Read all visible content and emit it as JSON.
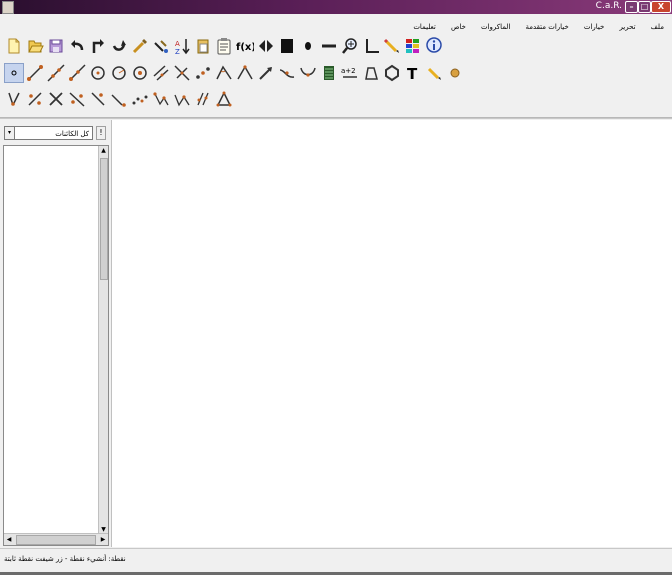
{
  "window": {
    "title": "C.a.R."
  },
  "menu": {
    "items": [
      "ملف",
      "تحرير",
      "خيارات",
      "خيارات متقدمة",
      "الماكروات",
      "خاص",
      "تعليمات"
    ]
  },
  "toolbar": {
    "row1": [
      "new-file-icon",
      "open-file-icon",
      "save-file-icon",
      "undo-icon",
      "redo-reset-icon",
      "back-icon",
      "delete-icon",
      "edit-icon",
      "sort-icon",
      "clipboard-icon",
      "clipboard-text-icon",
      "function-icon",
      "mirror-icon",
      "black-square-icon",
      "dot-icon",
      "line-thickness-icon",
      "zoom-icon",
      "axes-icon",
      "pencil-icon",
      "color-grid-icon",
      "info-icon"
    ],
    "row1_function_label": "f(x)",
    "row2": [
      "point-icon",
      "segment-icon",
      "line-icon",
      "ray-icon",
      "circle-icon",
      "circle-radius-icon",
      "compass-circle-icon",
      "parallel-icon",
      "perpendicular-icon",
      "midpoint-icon",
      "angle-icon",
      "fixed-angle-icon",
      "vector-icon",
      "arc-icon",
      "conic-icon",
      "function-graph-icon",
      "expression-icon",
      "polygon-icon",
      "regular-polygon-icon",
      "text-icon",
      "pencil-tool-icon",
      "color-ball-icon"
    ],
    "row2_expression_label": "a+2",
    "row2_text_label": "T",
    "row3": [
      "intersection-icon",
      "bisector-icon",
      "cross-icon",
      "tangent-icon",
      "reflect-icon",
      "rotate-icon",
      "chain-icon",
      "triangle-chain-icon",
      "broken-line-icon",
      "multiple-points-icon",
      "triangle-icon"
    ]
  },
  "sidepanel": {
    "combo_value": "كل الكائنات",
    "combo_arrow": "▾",
    "exclaim": "!",
    "scroll_up": "▲",
    "scroll_down": "▼",
    "scroll_left": "◀",
    "scroll_right": "▶"
  },
  "window_buttons": {
    "minimize": "–",
    "maximize": "□",
    "close": "X"
  },
  "status": {
    "text": "نقطة: أنشيء نقطة - زر شيفت نقطة ثابتة"
  },
  "colors": {
    "titlebar": "#5a1f57",
    "selected_tool": "#c6d4ee",
    "canvas": "#ffffff"
  }
}
